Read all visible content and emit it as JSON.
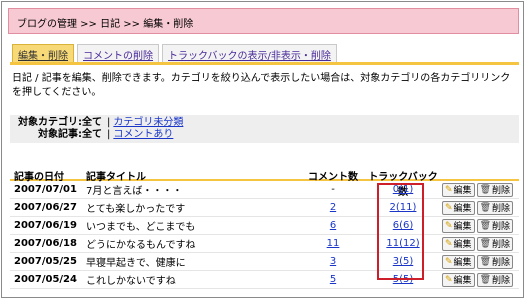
{
  "header": {
    "breadcrumb": "ブログの管理 >> 日記 >> 編集・削除"
  },
  "tabs": [
    {
      "label": "編集・削除",
      "active": true
    },
    {
      "label": "コメントの削除",
      "active": false
    },
    {
      "label": "トラックバックの表示/非表示・削除",
      "active": false
    }
  ],
  "description": "日記 / 記事を編集、削除できます。カテゴリを絞り込んで表示したい場合は、対象カテゴリの各カテゴリリンクを押してください。",
  "filters": {
    "category_label": "対象カテゴリ:",
    "category_value": "全て",
    "category_link": "カテゴリ未分類",
    "article_label": "対象記事:",
    "article_value": "全て",
    "article_link": "コメントあり"
  },
  "table": {
    "headers": {
      "date": "記事の日付",
      "title": "記事タイトル",
      "comments": "コメント数",
      "trackbacks": "トラックバック数"
    },
    "rows": [
      {
        "date": "2007/07/01",
        "title": "7月と言えば・・・・",
        "comments": "-",
        "comments_link": false,
        "trackbacks": "0(1)"
      },
      {
        "date": "2007/06/27",
        "title": "とても楽しかったです",
        "comments": "2",
        "comments_link": true,
        "trackbacks": "2(11)"
      },
      {
        "date": "2007/06/19",
        "title": "いつまでも、どこまでも",
        "comments": "6",
        "comments_link": true,
        "trackbacks": "6(6)"
      },
      {
        "date": "2007/06/18",
        "title": "どうにかなるもんですね",
        "comments": "11",
        "comments_link": true,
        "trackbacks": "11(12)"
      },
      {
        "date": "2007/05/25",
        "title": "早寝早起きで、健康に",
        "comments": "3",
        "comments_link": true,
        "trackbacks": "3(5)"
      },
      {
        "date": "2007/05/24",
        "title": "これしかないですね",
        "comments": "5",
        "comments_link": true,
        "trackbacks": "5(5)"
      }
    ],
    "edit_label": "編集",
    "delete_label": "削除"
  },
  "colors": {
    "header_bg": "#f7c9d2",
    "tab_active": "#f7d977",
    "accent_line": "#f5c542",
    "highlight_box": "#cc1f2a",
    "link": "#1a36c8"
  },
  "icons": {
    "edit": "pencil-icon",
    "delete": "trash-icon"
  }
}
